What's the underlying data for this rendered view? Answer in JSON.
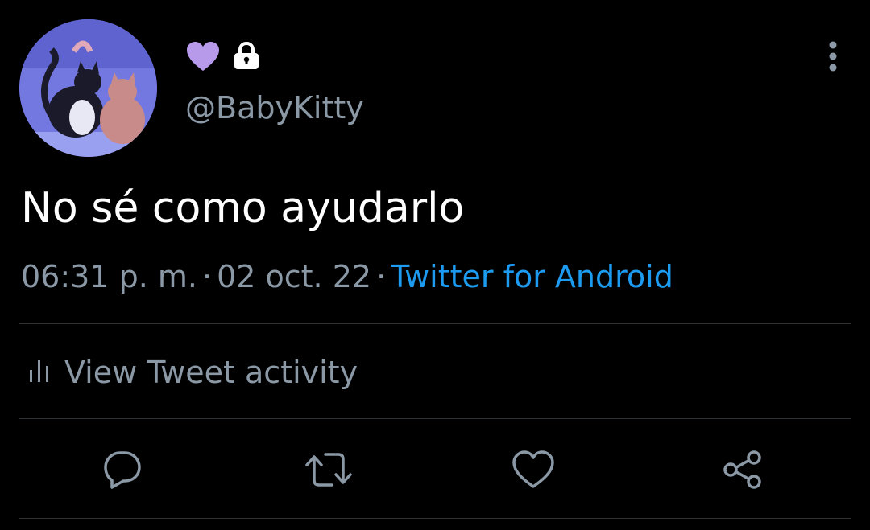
{
  "profile": {
    "handle": "@BabyKitty",
    "avatar_icon": "cats-avatar-icon",
    "heart_emoji_icon": "purple-heart-icon",
    "protected_icon": "lock-icon"
  },
  "tweet": {
    "text": "No sé como ayudarlo",
    "time": "06:31 p. m.",
    "separator": "·",
    "date": "02 oct. 22",
    "source": "Twitter for Android"
  },
  "activity": {
    "label": "View Tweet activity",
    "icon": "analytics-icon"
  },
  "actions": {
    "reply_icon": "reply-icon",
    "retweet_icon": "retweet-icon",
    "like_icon": "heart-icon",
    "share_icon": "share-icon"
  },
  "colors": {
    "background": "#000000",
    "text": "#ffffff",
    "secondary_text": "#8b98a5",
    "link": "#1d9bf0",
    "purple_heart": "#b79bea",
    "divider": "#2f3336"
  }
}
